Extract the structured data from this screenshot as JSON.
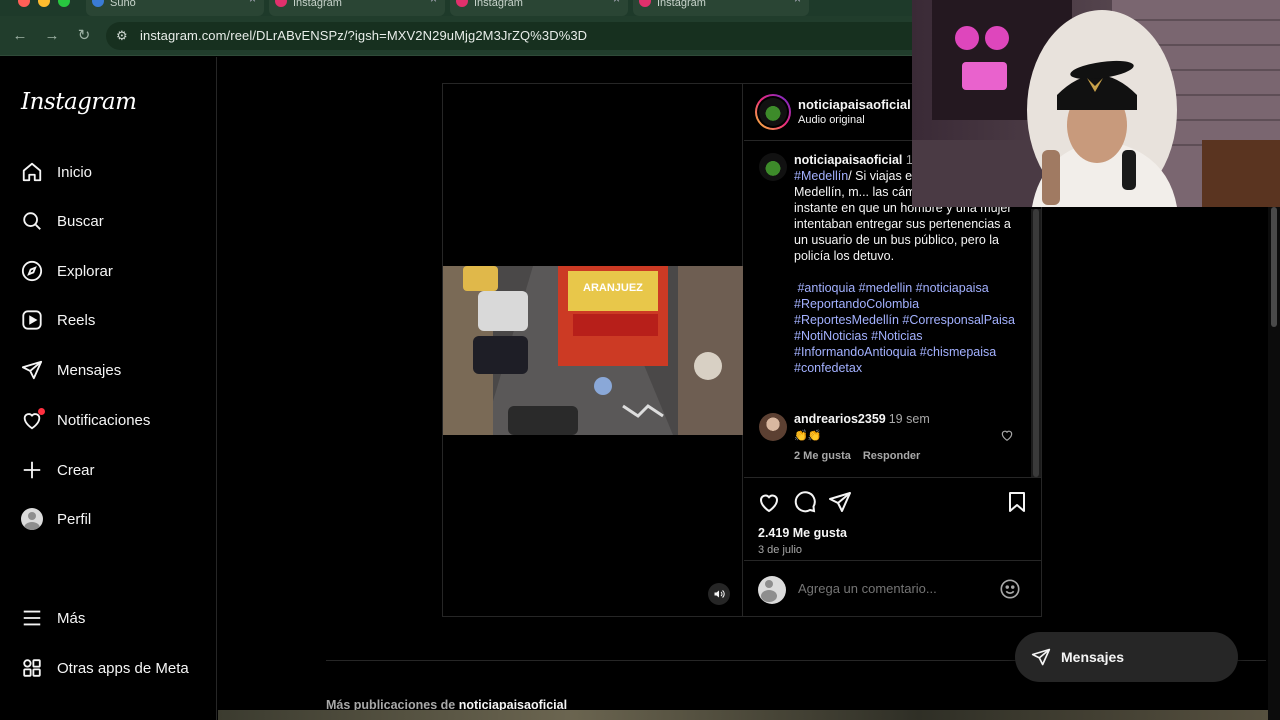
{
  "browser": {
    "tabs": [
      {
        "label": "Suno"
      },
      {
        "label": "Instagram"
      },
      {
        "label": "Instagram"
      },
      {
        "label": "Instagram"
      }
    ],
    "url": "instagram.com/reel/DLrABvENSPz/?igsh=MXV2N29uMjg2M3JrZQ%3D%3D"
  },
  "sidebar": {
    "logo": "Instagram",
    "items": [
      {
        "label": "Inicio",
        "icon": "home-icon"
      },
      {
        "label": "Buscar",
        "icon": "search-icon"
      },
      {
        "label": "Explorar",
        "icon": "compass-icon"
      },
      {
        "label": "Reels",
        "icon": "reels-icon"
      },
      {
        "label": "Mensajes",
        "icon": "send-icon"
      },
      {
        "label": "Notificaciones",
        "icon": "heart-icon"
      },
      {
        "label": "Crear",
        "icon": "plus-icon"
      },
      {
        "label": "Perfil",
        "icon": "avatar"
      }
    ],
    "more": "Más",
    "meta_apps": "Otras apps de Meta"
  },
  "post": {
    "username": "noticiapaisaoficial",
    "audio": "Audio original",
    "caption": {
      "username": "noticiapaisaoficial",
      "time": "1",
      "tag_city": "#Medellín",
      "text": "/ Si viajas e... centro de Medellín, m... las cámaras capturaron el instante en que un hombre y una mujer intentaban entregar sus pertenencias a un usuario de un bus público, pero la policía los detuvo.",
      "hashtags": [
        "#antioquia",
        "#medellin",
        "#noticiapaisa",
        "#ReportandoColombia",
        "#ReportesMedellín",
        "#CorresponsalPaisa",
        "#NotiNoticias",
        "#Noticias",
        "#InformandoAntioquia",
        "#chismepaisa",
        "#confedetax"
      ]
    },
    "comment": {
      "username": "andrearios2359",
      "time": "19 sem",
      "text": "👏👏",
      "likes": "2 Me gusta",
      "reply": "Responder"
    },
    "likes": "2.419 Me gusta",
    "date": "3 de julio",
    "comment_placeholder": "Agrega un comentario..."
  },
  "more_posts": {
    "prefix": "Más publicaciones de",
    "user": "noticiapaisaoficial"
  },
  "messages_float": "Mensajes",
  "colors": {
    "hashtag": "#a3b1ff",
    "notification_dot": "#ff3040",
    "background": "#000000"
  }
}
